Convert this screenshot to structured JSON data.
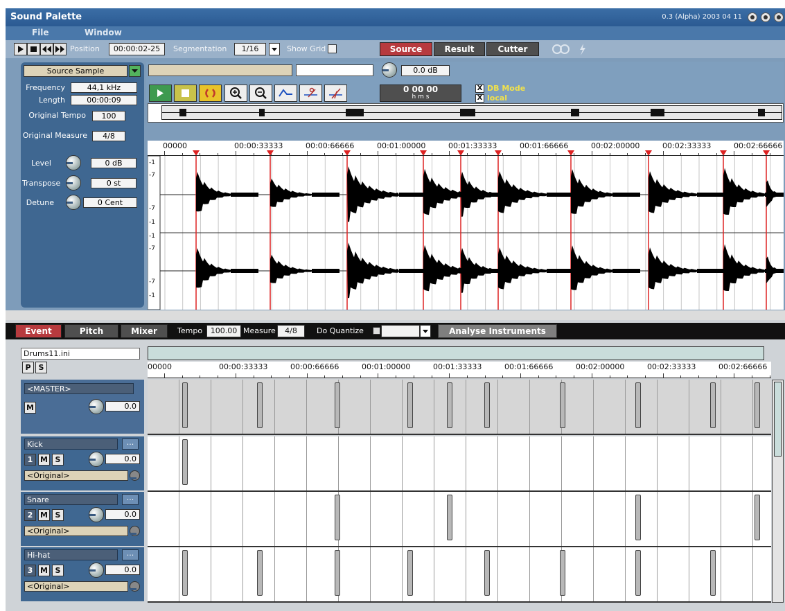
{
  "titlebar": {
    "title": "Sound Palette",
    "version": "0.3 (Alpha) 2003 04 11"
  },
  "menu": {
    "file": "File",
    "window": "Window"
  },
  "toolbar": {
    "position_label": "Position",
    "position_value": "00:00:02-25",
    "segmentation_label": "Segmentation",
    "segmentation_value": "1/16",
    "show_grid_label": "Show Grid",
    "tab_source": "Source",
    "tab_result": "Result",
    "tab_cutter": "Cutter"
  },
  "source_panel": {
    "sample_select": "Source Sample",
    "frequency_label": "Frequency",
    "frequency_value": "44,1 kHz",
    "length_label": "Length",
    "length_value": "00:00:09",
    "tempo_label": "Original Tempo",
    "tempo_value": "100",
    "measure_label": "Original Measure",
    "measure_value": "4/8",
    "level_label": "Level",
    "level_value": "0 dB",
    "transpose_label": "Transpose",
    "transpose_value": "0 st",
    "detune_label": "Detune",
    "detune_value": "0 Cent"
  },
  "wave_header": {
    "gain_value": "0.0 dB",
    "time_display": "0 00 00",
    "time_units": "h m s",
    "db_mode_label": "DB Mode",
    "local_label": "local",
    "ruler": [
      "00000",
      "00:00:33333",
      "00:00:66666",
      "00:01:00000",
      "00:01:33333",
      "00:01:66666",
      "00:02:00000",
      "00:02:33333",
      "00:02:66666"
    ],
    "amp_ticks": [
      "-1",
      "-7",
      "-7",
      "-1",
      "-1",
      "-7",
      "-7",
      "-1"
    ]
  },
  "event_bar": {
    "tab_event": "Event",
    "tab_pitch": "Pitch",
    "tab_mixer": "Mixer",
    "tempo_label": "Tempo",
    "tempo_value": "100.00",
    "measure_label": "Measure",
    "measure_value": "4/8",
    "quantize_label": "Do Quantize",
    "analyse_button": "Analyse Instruments"
  },
  "tracks_area": {
    "file_name": "Drums11.ini",
    "p_label": "P",
    "s_label": "S",
    "ruler": [
      "00000",
      "00:00:33333",
      "00:00:66666",
      "00:01:00000",
      "00:01:33333",
      "00:01:66666",
      "00:02:00000",
      "00:02:33333",
      "00:02:66666"
    ],
    "master": {
      "name": "<MASTER>",
      "m": "M",
      "value": "0.0"
    },
    "tracks": [
      {
        "name": "Kick",
        "num": "1",
        "m": "M",
        "s": "S",
        "value": "0.0",
        "preset": "<Original>"
      },
      {
        "name": "Snare",
        "num": "2",
        "m": "M",
        "s": "S",
        "value": "0.0",
        "preset": "<Original>"
      },
      {
        "name": "Hi-hat",
        "num": "3",
        "m": "M",
        "s": "S",
        "value": "0.0",
        "preset": "<Original>"
      }
    ],
    "more_label": "..."
  }
}
